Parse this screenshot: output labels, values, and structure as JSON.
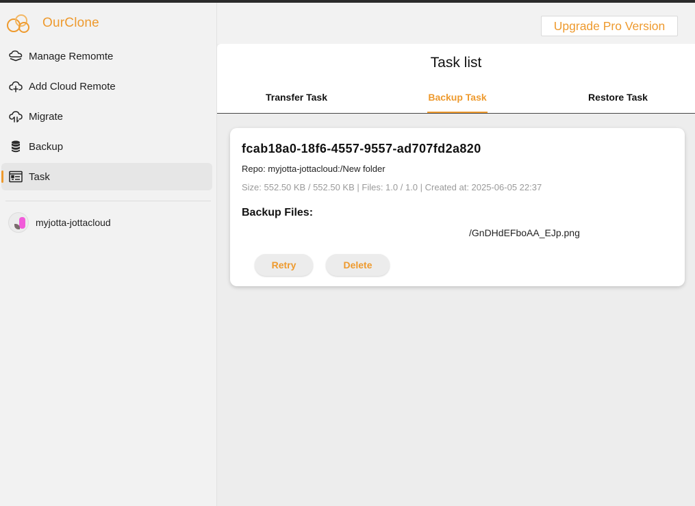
{
  "app": {
    "name": "OurClone"
  },
  "upgrade": {
    "label": "Upgrade Pro Version"
  },
  "sidebar": {
    "items": [
      {
        "label": "Manage Remomte",
        "icon": "cloud-stack-icon"
      },
      {
        "label": "Add Cloud Remote",
        "icon": "cloud-add-icon"
      },
      {
        "label": "Migrate",
        "icon": "cloud-sync-icon"
      },
      {
        "label": "Backup",
        "icon": "database-icon"
      },
      {
        "label": "Task",
        "icon": "task-list-icon",
        "active": true
      }
    ],
    "remotes": [
      {
        "label": "myjotta-jottacloud",
        "icon": "jottacloud-avatar-icon"
      }
    ]
  },
  "main": {
    "title": "Task list",
    "tabs": [
      {
        "label": "Transfer Task"
      },
      {
        "label": "Backup Task",
        "active": true
      },
      {
        "label": "Restore Task"
      }
    ],
    "task": {
      "id": "fcab18a0-18f6-4557-9557-ad707fd2a820",
      "repo": "Repo: myjotta-jottacloud:/New folder",
      "meta": "Size: 552.50 KB / 552.50 KB | Files: 1.0 / 1.0 | Created at: 2025-06-05 22:37",
      "files_heading": "Backup Files:",
      "files": [
        "/GnDHdEFboAA_EJp.png"
      ],
      "retry_label": "Retry",
      "delete_label": "Delete"
    }
  },
  "colors": {
    "accent": "#ee9a2e",
    "sidebar_bg": "#f2f2f2",
    "main_bg": "#ededed"
  }
}
